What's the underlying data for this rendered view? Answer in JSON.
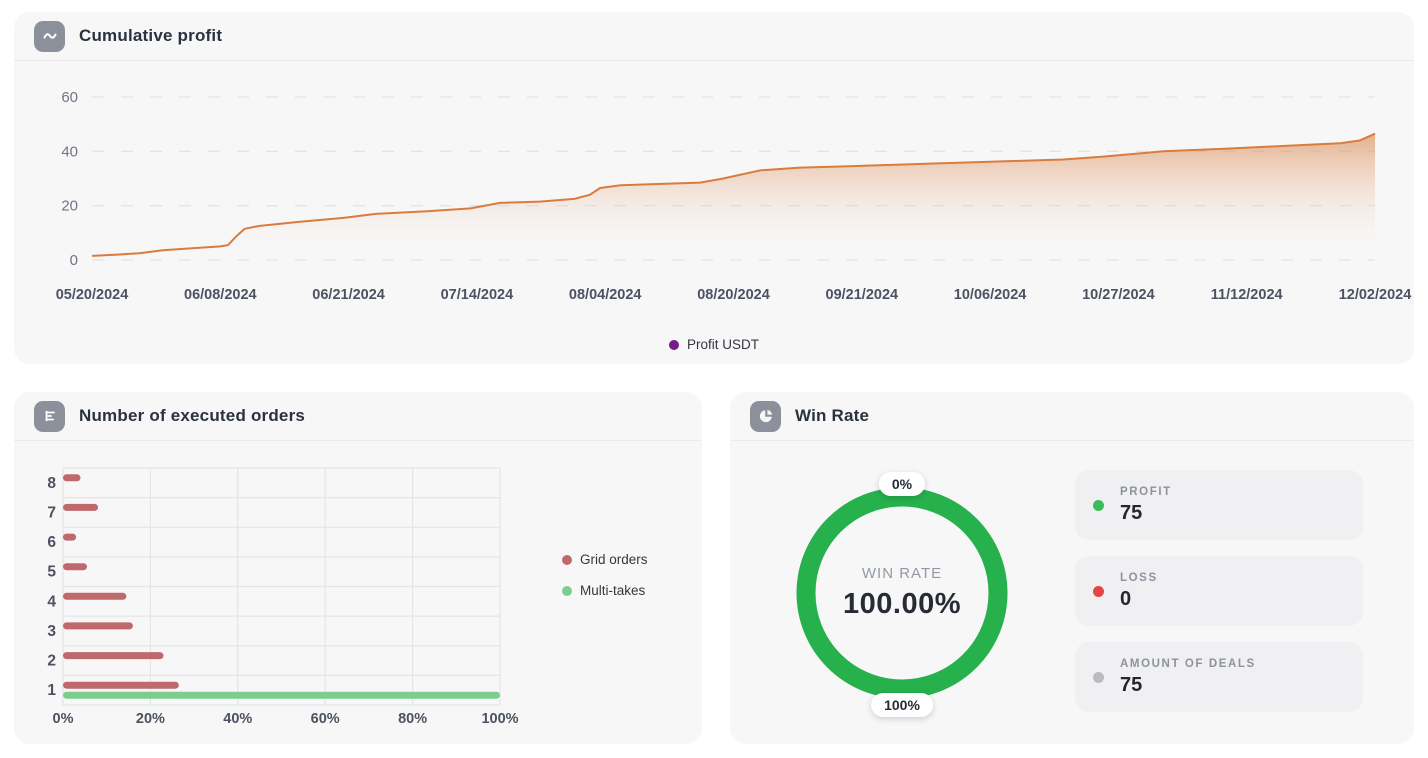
{
  "panels": {
    "cumulative_profit": {
      "title": "Cumulative profit",
      "icon": "line-chart-icon",
      "legend": [
        {
          "label": "Profit USDT",
          "color": "#771d86"
        }
      ]
    },
    "executed_orders": {
      "title": "Number of executed orders",
      "icon": "bar-chart-icon",
      "legend": [
        {
          "label": "Grid orders",
          "color": "#c0696c"
        },
        {
          "label": "Multi-takes",
          "color": "#7ccd8e"
        }
      ]
    },
    "win_rate": {
      "title": "Win Rate",
      "icon": "pie-chart-icon",
      "gauge": {
        "center_label": "WIN RATE",
        "center_value": "100.00%",
        "top_badge": "0%",
        "bottom_badge": "100%",
        "ring_color": "#26b14d",
        "track_color": "#26b14d",
        "value_percent": 100
      },
      "stats": [
        {
          "label": "PROFIT",
          "value": "75",
          "dot_color": "#3dbb5b"
        },
        {
          "label": "LOSS",
          "value": "0",
          "dot_color": "#e14747"
        },
        {
          "label": "AMOUNT OF DEALS",
          "value": "75",
          "dot_color": "#b9bcc1"
        }
      ]
    }
  },
  "chart_data": [
    {
      "type": "area",
      "title": "Cumulative profit",
      "ylabel": "Profit USDT",
      "ylim": [
        0,
        60
      ],
      "yticks": [
        0,
        20,
        40,
        60
      ],
      "grid": "dashed-horizontal",
      "legend_position": "bottom-center",
      "x_tick_labels": [
        "05/20/2024",
        "06/08/2024",
        "06/21/2024",
        "07/14/2024",
        "08/04/2024",
        "08/20/2024",
        "09/21/2024",
        "10/06/2024",
        "10/27/2024",
        "11/12/2024",
        "12/02/2024"
      ],
      "fill_top": "rgba(213,118,52,0.55)",
      "fill_bottom": "rgba(255,255,255,0)",
      "series": [
        {
          "name": "Profit USDT",
          "color": "#d97c3e",
          "points": [
            [
              0.0,
              1.5
            ],
            [
              0.02,
              2.0
            ],
            [
              0.037,
              2.5
            ],
            [
              0.055,
              3.6
            ],
            [
              0.084,
              4.5
            ],
            [
              0.1,
              5.0
            ],
            [
              0.106,
              5.5
            ],
            [
              0.112,
              8.5
            ],
            [
              0.119,
              11.5
            ],
            [
              0.13,
              12.5
            ],
            [
              0.16,
              14.0
            ],
            [
              0.196,
              15.5
            ],
            [
              0.222,
              17.0
            ],
            [
              0.263,
              18.0
            ],
            [
              0.295,
              19.0
            ],
            [
              0.318,
              21.0
            ],
            [
              0.349,
              21.5
            ],
            [
              0.376,
              22.5
            ],
            [
              0.388,
              24.0
            ],
            [
              0.396,
              26.5
            ],
            [
              0.412,
              27.5
            ],
            [
              0.474,
              28.5
            ],
            [
              0.492,
              30.0
            ],
            [
              0.521,
              33.0
            ],
            [
              0.552,
              34.0
            ],
            [
              0.59,
              34.5
            ],
            [
              0.653,
              35.5
            ],
            [
              0.688,
              36.0
            ],
            [
              0.757,
              37.0
            ],
            [
              0.787,
              38.0
            ],
            [
              0.835,
              40.0
            ],
            [
              0.885,
              41.0
            ],
            [
              0.952,
              42.5
            ],
            [
              0.973,
              43.0
            ],
            [
              0.988,
              44.0
            ],
            [
              1.0,
              46.5
            ]
          ]
        }
      ]
    },
    {
      "type": "bar",
      "orientation": "horizontal",
      "title": "Number of executed orders",
      "categories": [
        "8",
        "7",
        "6",
        "5",
        "4",
        "3",
        "2",
        "1"
      ],
      "series": [
        {
          "name": "Grid orders",
          "color": "#c0696c",
          "values": [
            4,
            8,
            3,
            5.5,
            14.5,
            16,
            23,
            26.5
          ]
        },
        {
          "name": "Multi-takes",
          "color": "#7ccd8e",
          "values": [
            0,
            0,
            0,
            0,
            0,
            0,
            0,
            100
          ]
        }
      ],
      "xlim": [
        0,
        100
      ],
      "xticks": [
        0,
        20,
        40,
        60,
        80,
        100
      ],
      "xtick_labels": [
        "0%",
        "20%",
        "40%",
        "60%",
        "80%",
        "100%"
      ],
      "grid": "on",
      "legend_position": "right"
    },
    {
      "type": "pie",
      "variant": "donut-gauge",
      "title": "Win Rate",
      "labels": {
        "center": "WIN RATE",
        "center_value": "100.00%",
        "top": "0%",
        "bottom": "100%"
      },
      "segments": [
        {
          "name": "win rate",
          "value": 100,
          "color": "#26b14d"
        }
      ]
    }
  ]
}
